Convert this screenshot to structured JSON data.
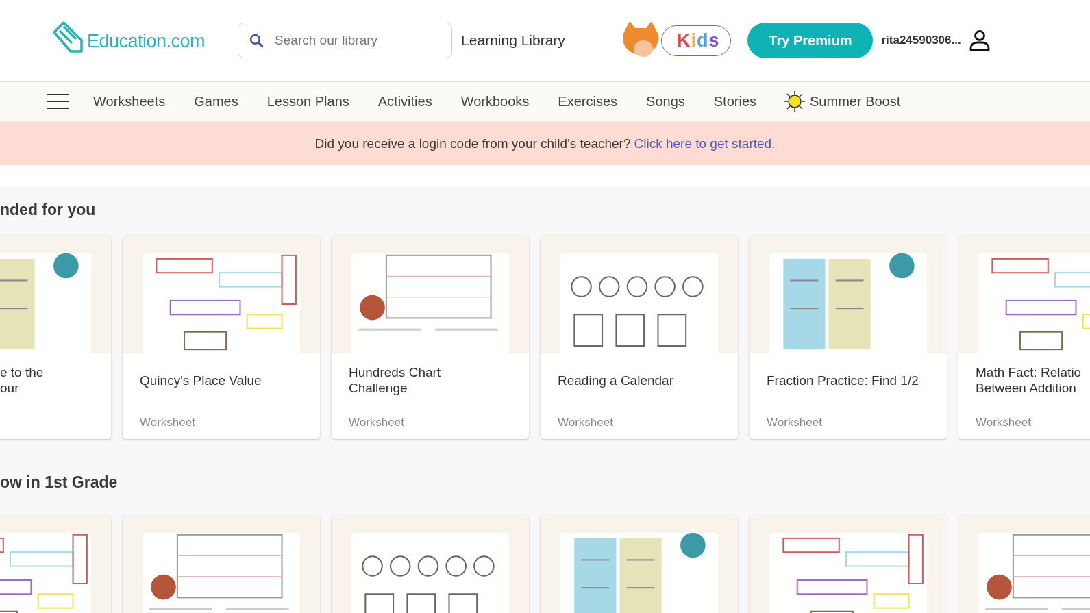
{
  "header": {
    "logo": "Education.com",
    "search": {
      "placeholder": "Search our library"
    },
    "library_link": "Learning Library",
    "kids_badge": "Kids",
    "premium_button": "Try Premium",
    "username": "rita24590306..."
  },
  "nav": {
    "items": [
      "Worksheets",
      "Games",
      "Lesson Plans",
      "Activities",
      "Workbooks",
      "Exercises",
      "Songs",
      "Stories"
    ],
    "summer": "Summer Boost"
  },
  "banner": {
    "text": "Did you receive a login code from your child's teacher?",
    "link": "Click here to get started."
  },
  "sections": [
    {
      "title": "nded for you",
      "cards": [
        {
          "kind": "picture",
          "title": "e to the\nour"
        },
        {
          "kind": "picture",
          "title": "Quincy's Place Value",
          "type": "Worksheet"
        },
        {
          "kind": "picture",
          "title": "Hundreds Chart\nChallenge",
          "type": "Worksheet"
        },
        {
          "kind": "picture",
          "title": "Reading a Calendar",
          "type": "Worksheet"
        },
        {
          "kind": "picture",
          "title": "Fraction Practice: Find 1/2",
          "type": "Worksheet"
        },
        {
          "kind": "picture",
          "title": "Math Fact: Relatio\nBetween Addition",
          "type": "Worksheet"
        }
      ]
    },
    {
      "title": "ow in 1st Grade"
    }
  ]
}
